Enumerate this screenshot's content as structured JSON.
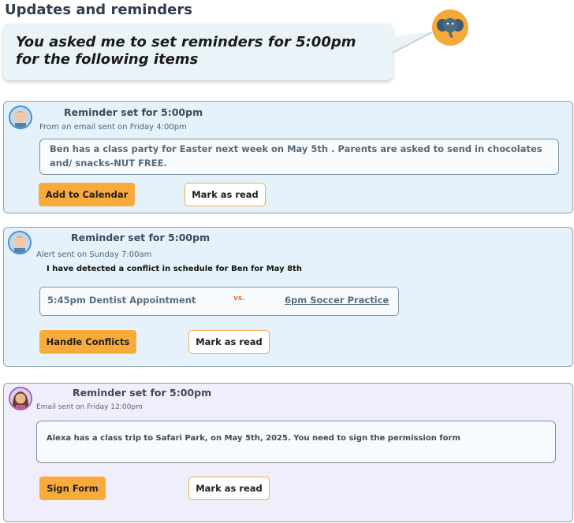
{
  "header": {
    "title": "Updates and reminders"
  },
  "assistant": {
    "message": "You asked me to set reminders for 5:00pm for the following items",
    "mascot_icon": "elephant-icon",
    "mascot_color": "#f5a93a"
  },
  "reminders": [
    {
      "title": "Reminder set for 5:00pm",
      "source": "From an email sent on Friday 4:00pm",
      "message": "Ben has a class party for Easter next week on May 5th . Parents are asked to send in chocolates and/ snacks-NUT FREE.",
      "primary_action": "Add to Calendar",
      "secondary_action": "Mark as read",
      "avatar_icon": "child-avatar-boy"
    },
    {
      "title": "Reminder set for 5:00pm",
      "source": "Alert sent on Sunday 7:00am",
      "alert": "I have detected a conflict in schedule for Ben for May 8th",
      "conflict": {
        "left": "5:45pm Dentist Appointment",
        "vs": "vs.",
        "right": "6pm Soccer Practice"
      },
      "primary_action": "Handle Conflicts",
      "secondary_action": "Mark as read",
      "avatar_icon": "child-avatar-boy"
    },
    {
      "title": "Reminder set for 5:00pm",
      "source": "Email sent on Friday 12:00pm",
      "message": "Alexa has a class trip to Safari Park, on May 5th, 2025. You need to sign the permission form",
      "primary_action": "Sign Form",
      "secondary_action": "Mark as read",
      "avatar_icon": "child-avatar-girl"
    }
  ],
  "colors": {
    "accent": "#f8ab3b",
    "card_blue": "#e5f2fb",
    "card_purple": "#f1eefc",
    "conflict_vs": "#e0701e"
  }
}
